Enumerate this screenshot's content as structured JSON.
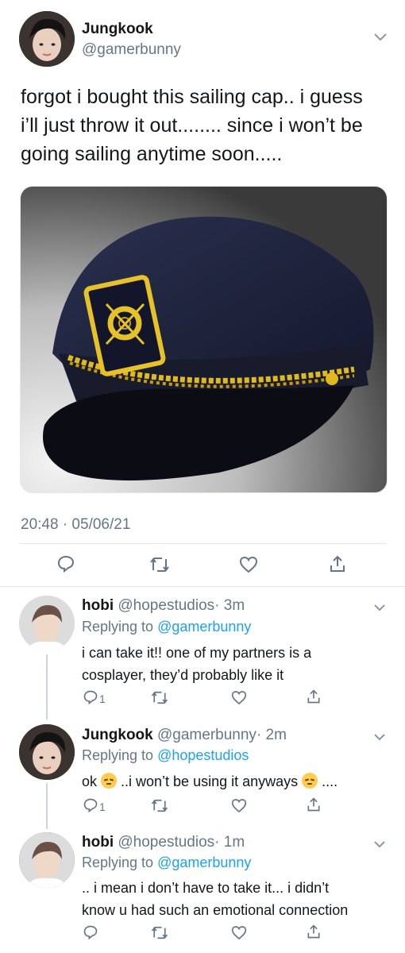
{
  "tweet": {
    "author_name": "Jungkook",
    "author_handle": "@gamerbunny",
    "text_lines": [
      "forgot i bought this sailing cap.. i guess",
      "i’ll just throw it out........ since i won’t be",
      "going sailing anytime soon....."
    ],
    "media": {
      "description_icon": "sailing-cap-photo",
      "colors": {
        "cap": "#1a1e33",
        "braid": "#e0b820"
      }
    },
    "timestamp": "20:48 · 05/06/21"
  },
  "actions": {
    "icons": [
      "reply-icon",
      "retweet-icon",
      "like-icon",
      "share-icon"
    ]
  },
  "replies": [
    {
      "name": "hobi",
      "handle": "@hopestudios",
      "time": "· 3m",
      "replying_prefix": "Replying to ",
      "replying_to": "@gamerbunny",
      "lines": [
        "i can take it!! one of my partners is a",
        "cosplayer, they’d probably like it"
      ],
      "reply_count": "1"
    },
    {
      "name": "Jungkook",
      "handle": "@gamerbunny",
      "time": "· 2m",
      "replying_prefix": "Replying to ",
      "replying_to": "@hopestudios",
      "text_parts": [
        "ok ",
        " ..i won’t be using it anyways ",
        " ...."
      ],
      "reply_count": "1"
    },
    {
      "name": "hobi",
      "handle": "@hopestudios",
      "time": "· 1m",
      "replying_prefix": "Replying to ",
      "replying_to": "@gamerbunny",
      "lines": [
        ".. i mean i don’t have to take it... i didn’t",
        "know u had such an emotional connection"
      ],
      "reply_count": ""
    }
  ],
  "colors": {
    "accent": "#1da1f2",
    "muted": "#657786",
    "text": "#14171a",
    "divider": "#e1e8ed"
  }
}
